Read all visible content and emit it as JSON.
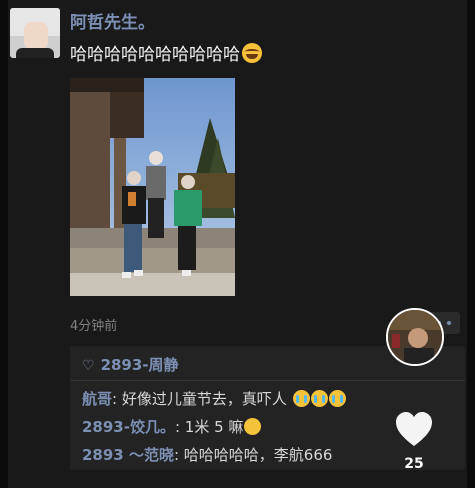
{
  "post": {
    "username": "阿哲先生。",
    "text": "哈哈哈哈哈哈哈哈哈哈",
    "emoji_icon": "laughing-tears-emoji",
    "time": "4分钟前"
  },
  "likes": {
    "heart_icon": "♡",
    "names": "2893-周静"
  },
  "comments": [
    {
      "name": "航哥",
      "text": ": 好像过儿童节去，真吓人",
      "emoji": "crying-emoji"
    },
    {
      "name": "2893-饺几。",
      "text": ": 1米 5 嘛",
      "emoji": "sweat-emoji"
    },
    {
      "name": "2893 ～范晓",
      "text": ": 哈哈哈哈哈，李航666",
      "emoji": ""
    }
  ],
  "actions": {
    "like_count": "25"
  },
  "colors": {
    "name_blue": "#7c8fb4",
    "background": "#191919",
    "comment_box": "#232323"
  }
}
